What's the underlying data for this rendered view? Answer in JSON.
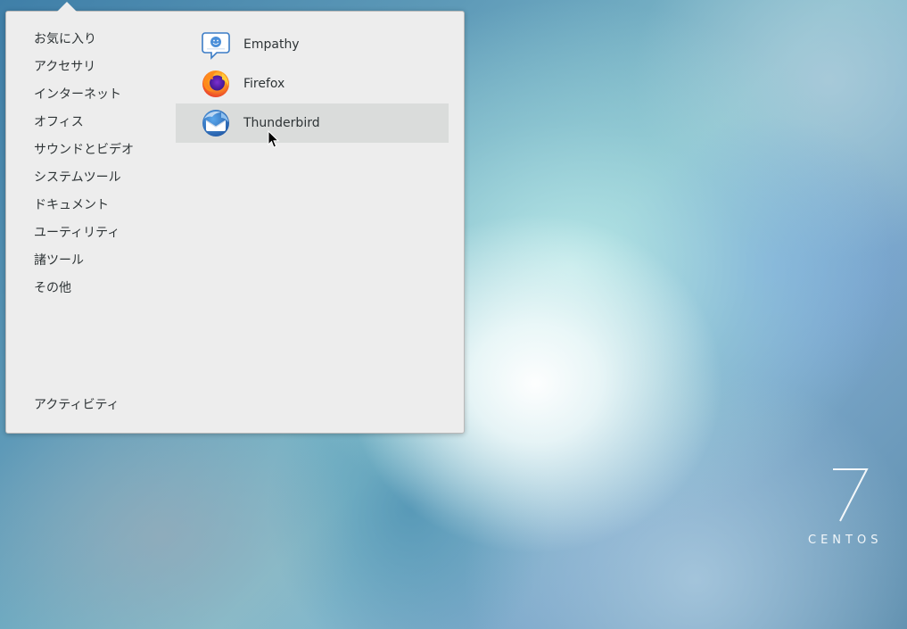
{
  "menu": {
    "categories": [
      {
        "label": "お気に入り",
        "name": "favorites"
      },
      {
        "label": "アクセサリ",
        "name": "accessories"
      },
      {
        "label": "インターネット",
        "name": "internet"
      },
      {
        "label": "オフィス",
        "name": "office"
      },
      {
        "label": "サウンドとビデオ",
        "name": "sound-video"
      },
      {
        "label": "システムツール",
        "name": "system-tools"
      },
      {
        "label": "ドキュメント",
        "name": "documentation"
      },
      {
        "label": "ユーティリティ",
        "name": "utilities"
      },
      {
        "label": "諸ツール",
        "name": "sundry"
      },
      {
        "label": "その他",
        "name": "other"
      }
    ],
    "apps": [
      {
        "label": "Empathy",
        "icon": "empathy-icon"
      },
      {
        "label": "Firefox",
        "icon": "firefox-icon"
      },
      {
        "label": "Thunderbird",
        "icon": "thunderbird-icon",
        "hovered": true
      }
    ],
    "activities_label": "アクティビティ"
  },
  "branding": {
    "version": "7",
    "distro": "CENTOS"
  },
  "colors": {
    "menu_bg": "#ededed",
    "hover_bg": "#dadcdb",
    "text": "#2e3436"
  }
}
